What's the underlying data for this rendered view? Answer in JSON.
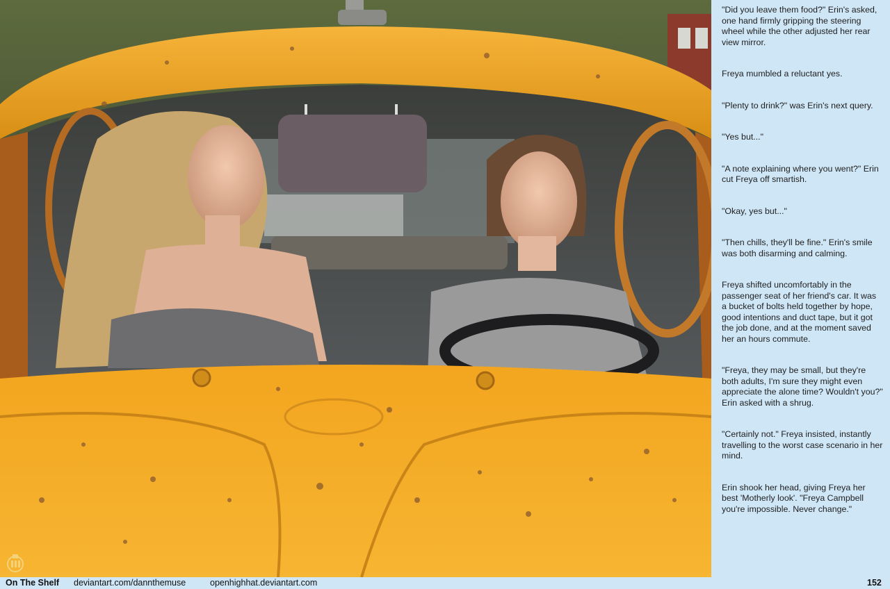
{
  "story": {
    "paragraphs": [
      "\"Did you leave them food?\" Erin's asked, one hand firmly gripping the steering wheel while the other adjusted her rear view mirror.",
      "Freya mumbled a reluctant yes.",
      "\"Plenty to drink?\" was Erin's next query.",
      "\"Yes but...\"",
      "\"A note explaining where you went?\" Erin cut Freya off smartish.",
      "\"Okay, yes but...\"",
      "\"Then chills, they'll be fine.\" Erin's smile was both disarming and calming.",
      "Freya shifted uncomfortably in the passenger seat of her friend's car. It was a bucket of bolts held together by hope, good intentions and duct tape, but it got the job done, and at the moment saved her an hours commute.",
      "\"Freya, they may be small, but they're both adults, I'm sure they might even appreciate the alone time? Wouldn't you?\" Erin asked with a shrug.",
      "\"Certainly not.\" Freya insisted, instantly travelling to the worst case scenario in her mind.",
      "Erin shook her head, giving Freya her best 'Motherly look'. \"Freya Campbell you're impossible. Never change.\""
    ]
  },
  "footer": {
    "title": "On The Shelf",
    "link_1": "deviantart.com/dannthemuse",
    "link_2": "openhighhat.deviantart.com",
    "page_number": "152"
  },
  "colors": {
    "panel_background": "#cfe6f6",
    "car_yellow": "#f2a51c",
    "rust": "#8a5a2e"
  }
}
